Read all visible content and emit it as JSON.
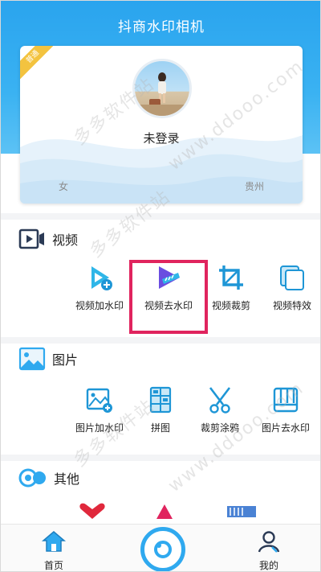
{
  "header": {
    "title": "抖商水印相机"
  },
  "profile": {
    "badge": "普通",
    "username": "未登录",
    "gender": "女",
    "region": "贵州"
  },
  "sections": {
    "video": {
      "title": "视频",
      "tools": [
        "视频加水印",
        "视频去水印",
        "视频裁剪",
        "视频特效"
      ]
    },
    "image": {
      "title": "图片",
      "tools": [
        "图片加水印",
        "拼图",
        "裁剪涂鸦",
        "图片去水印"
      ]
    },
    "other": {
      "title": "其他"
    }
  },
  "nav": {
    "home": "首页",
    "mine": "我的"
  },
  "watermark": {
    "text1": "多多软件站",
    "text2": "www.ddooo.com"
  },
  "colors": {
    "accent": "#2fa9ef",
    "highlight": "#e0245e",
    "badge": "#f3c33f"
  }
}
